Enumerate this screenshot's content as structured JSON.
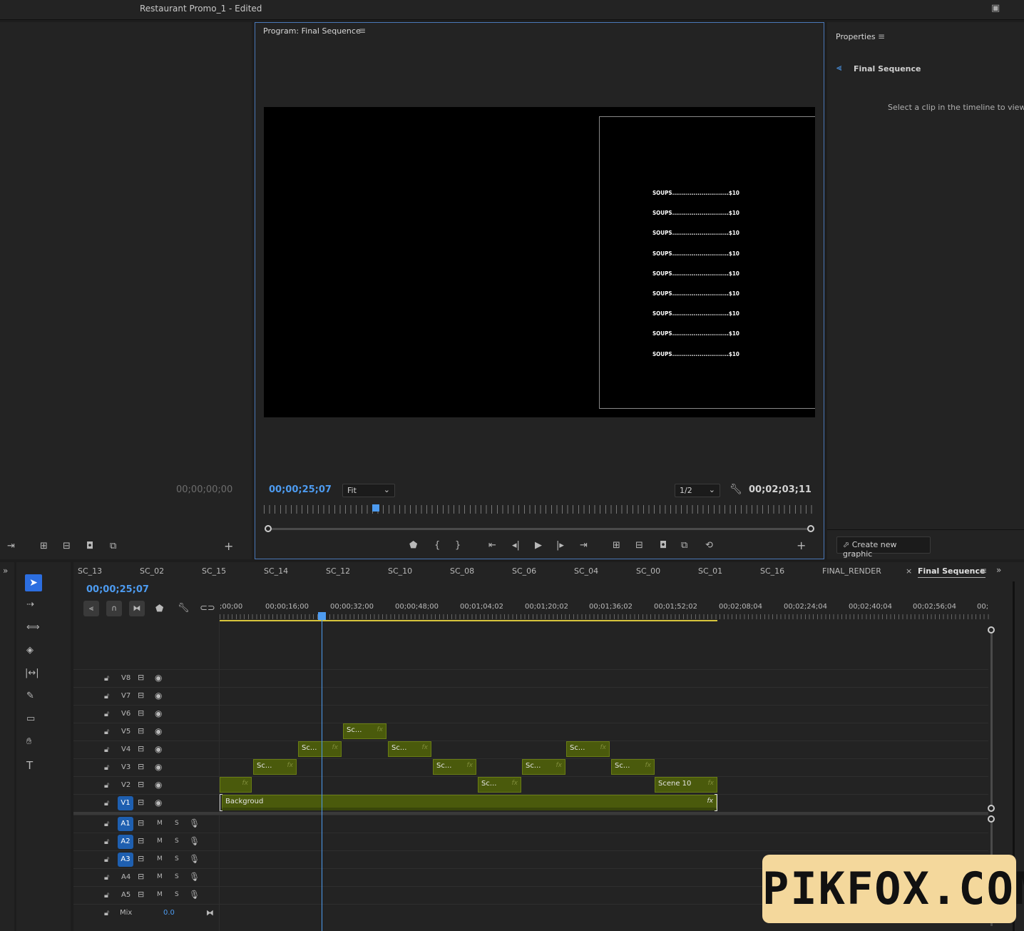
{
  "app": {
    "title": "Restaurant Promo_1",
    "status": " - Edited"
  },
  "source": {
    "timecode": "00;00;00;00"
  },
  "program": {
    "title": "Program: Final Sequence",
    "timecode_current": "00;00;25;07",
    "timecode_duration": "00;02;03;11",
    "zoom": "Fit",
    "resolution": "1/2"
  },
  "menu_lines": [
    "SOUPS.............................$10",
    "SOUPS.............................$10",
    "SOUPS.............................$10",
    "SOUPS.............................$10",
    "SOUPS.............................$10",
    "SOUPS.............................$10",
    "SOUPS.............................$10",
    "SOUPS.............................$10",
    "SOUPS.............................$10"
  ],
  "properties": {
    "title": "Properties",
    "sequence": "Final Sequence",
    "hint": "Select a clip in the timeline to view prop",
    "create_graphic": "Create new graphic"
  },
  "timeline": {
    "tabs": [
      "SC_13",
      "SC_02",
      "SC_15",
      "SC_14",
      "SC_12",
      "SC_10",
      "SC_08",
      "SC_06",
      "SC_04",
      "SC_00",
      "SC_01",
      "SC_16",
      "FINAL_RENDER",
      "Final Sequence"
    ],
    "timecode": "00;00;25;07",
    "ruler": [
      ";00;00",
      "00;00;16;00",
      "00;00;32;00",
      "00;00;48;00",
      "00;01;04;02",
      "00;01;20;02",
      "00;01;36;02",
      "00;01;52;02",
      "00;02;08;04",
      "00;02;24;04",
      "00;02;40;04",
      "00;02;56;04",
      "00;"
    ],
    "video_tracks": [
      "V8",
      "V7",
      "V6",
      "V5",
      "V4",
      "V3",
      "V2",
      "V1"
    ],
    "audio_tracks": [
      "A1",
      "A2",
      "A3",
      "A4",
      "A5"
    ],
    "mix": {
      "label": "Mix",
      "value": "0.0"
    },
    "clip_labels": {
      "sc": "Sc...",
      "scene10": "Scene 10",
      "background": "Backgroud",
      "fx": "fx",
      "m": "M",
      "s": "S"
    }
  },
  "watermark": "PIKFOX.COM",
  "colors": {
    "accent": "#4d9bf0",
    "clip": "#4a5a0c",
    "watermark_bg": "#f4d89c"
  }
}
